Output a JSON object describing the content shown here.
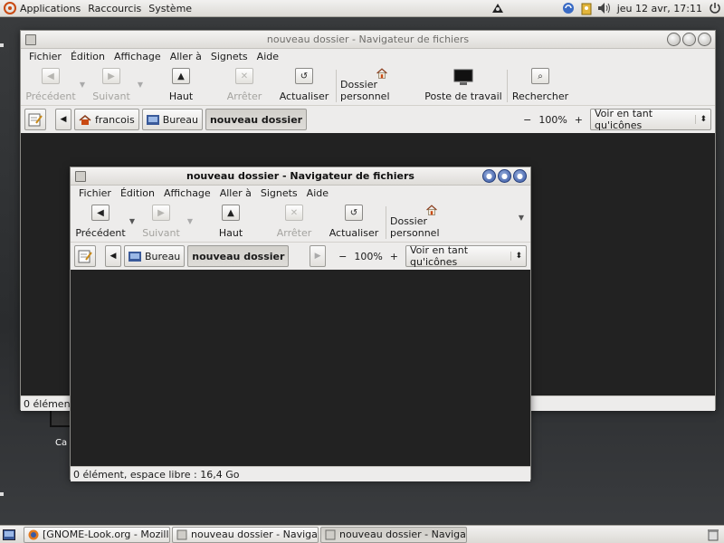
{
  "top_panel": {
    "menus": [
      "Applications",
      "Raccourcis",
      "Système"
    ],
    "clock": "jeu 12 avr, 17:11"
  },
  "back_window": {
    "title": "nouveau dossier - Navigateur de fichiers",
    "menus": [
      "Fichier",
      "Édition",
      "Affichage",
      "Aller à",
      "Signets",
      "Aide"
    ],
    "toolbar": {
      "back": "Précédent",
      "forward": "Suivant",
      "up": "Haut",
      "stop": "Arrêter",
      "reload": "Actualiser",
      "home": "Dossier personnel",
      "computer": "Poste de travail",
      "search": "Rechercher"
    },
    "path": [
      "francois",
      "Bureau",
      "nouveau dossier"
    ],
    "zoom": "100%",
    "view_mode": "Voir en tant qu'icônes",
    "status": "0 élément"
  },
  "front_window": {
    "title": "nouveau dossier - Navigateur de fichiers",
    "menus": [
      "Fichier",
      "Édition",
      "Affichage",
      "Aller à",
      "Signets",
      "Aide"
    ],
    "toolbar": {
      "back": "Précédent",
      "forward": "Suivant",
      "up": "Haut",
      "stop": "Arrêter",
      "reload": "Actualiser",
      "home": "Dossier personnel"
    },
    "path": [
      "Bureau",
      "nouveau dossier"
    ],
    "zoom": "100%",
    "view_mode": "Voir en tant qu'icônes",
    "status": "0 élément, espace libre : 16,4 Go"
  },
  "desktop": {
    "icon_label_fragment": "Ca"
  },
  "taskbar": {
    "tasks": [
      "[GNOME-Look.org - Mozill...",
      "nouveau dossier - Naviga...",
      "nouveau dossier - Naviga..."
    ]
  },
  "colors": {
    "content_bg": "#222222",
    "window_bg": "#edeceb",
    "active_button": "#3b5ba5",
    "ubuntu_orange": "#c94a13"
  }
}
